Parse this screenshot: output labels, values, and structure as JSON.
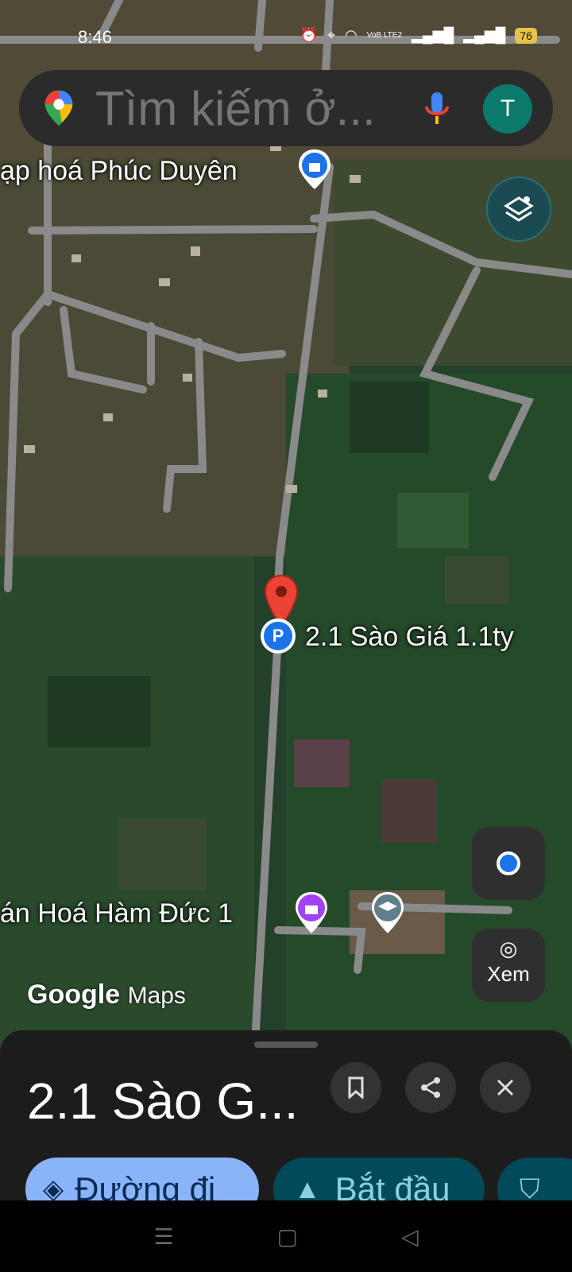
{
  "status": {
    "time": "8:46",
    "network": "VoB LTE2",
    "battery": "76"
  },
  "search": {
    "placeholder": "Tìm kiếm ở...",
    "avatar_letter": "T"
  },
  "map": {
    "labels": {
      "shop1": "ạp hoá Phúc Duyên",
      "pin": "2.1 Sào Giá 1.1ty",
      "shop2": "án Hoá Hàm Đức 1"
    },
    "logo_google": "Google",
    "logo_maps": "Maps",
    "xem_label": "Xem"
  },
  "sheet": {
    "title": "2.1 Sào G...",
    "directions_label": "Đường đi",
    "start_label": "Bắt đầu"
  },
  "colors": {
    "accent": "#1a73e8",
    "pin": "#ea4335",
    "directions_bg": "#8ab4f8",
    "start_bg": "#004a59"
  }
}
